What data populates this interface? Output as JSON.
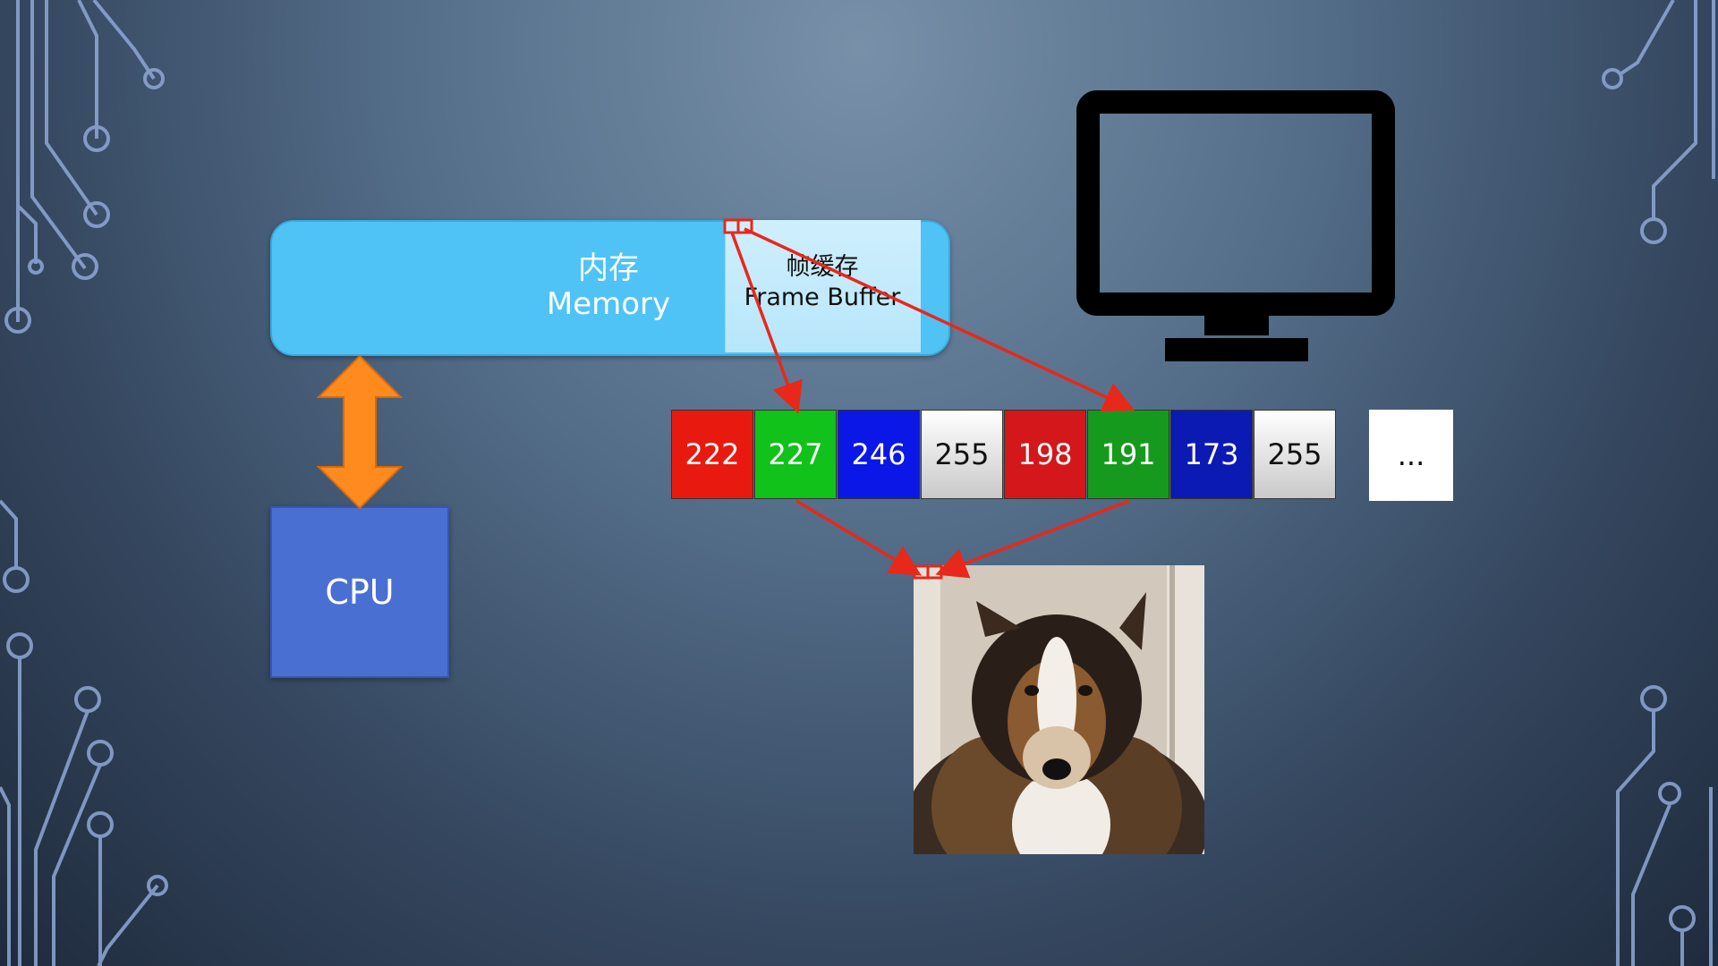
{
  "memory": {
    "label_zh": "内存",
    "label_en": "Memory"
  },
  "frame_buffer": {
    "label_zh": "帧缓存",
    "label_en": "Frame Buffer"
  },
  "cpu": {
    "label": "CPU"
  },
  "pixel_values": [
    {
      "value": "222",
      "color": "#e8190f"
    },
    {
      "value": "227",
      "color": "#11c21a"
    },
    {
      "value": "246",
      "color": "#0a17e6"
    },
    {
      "value": "255",
      "color": "white"
    },
    {
      "value": "198",
      "color": "#d3171b"
    },
    {
      "value": "191",
      "color": "#169a1e"
    },
    {
      "value": "173",
      "color": "#0b1ab2"
    },
    {
      "value": "255",
      "color": "white"
    }
  ],
  "ellipsis": "...",
  "colors": {
    "arrow_red": "#e8281a",
    "bidirectional_arrow": "#ff8a1e",
    "cpu_fill": "#4a6fd3",
    "memory_fill": "#4fc3f5"
  },
  "icons": {
    "monitor": "monitor-icon",
    "photo": "collie-dog-photo"
  }
}
